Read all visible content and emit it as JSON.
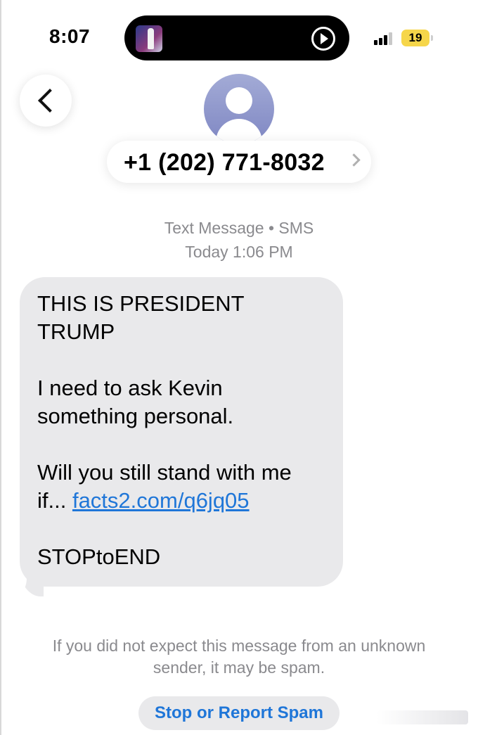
{
  "status_bar": {
    "time": "8:07",
    "battery": "19",
    "icons": [
      "now-playing-art",
      "play-icon",
      "signal-icon",
      "battery-icon"
    ]
  },
  "header": {
    "back_icon": "chevron-left-icon",
    "contact_number": "+1 (202) 771-8032",
    "avatar_icon": "person-icon"
  },
  "meta": {
    "service": "Text Message • SMS",
    "timestamp": "Today 1:06 PM"
  },
  "message": {
    "line1": "THIS IS PRESIDENT",
    "line2": "TRUMP",
    "line3": "I need to ask Kevin",
    "line4": "something personal.",
    "line5": "Will you still stand with me",
    "line6_prefix": "if... ",
    "link": "facts2.com/q6jq05",
    "line7": "STOPtoEND"
  },
  "spam_notice": {
    "line1": "If you did not expect this message from an unknown",
    "line2": "sender, it may be spam.",
    "button": "Stop or Report Spam"
  },
  "colors": {
    "bubble": "#e9e9eb",
    "link": "#1f76d8",
    "meta_text": "#8a8a8e",
    "battery": "#f6d64a"
  }
}
